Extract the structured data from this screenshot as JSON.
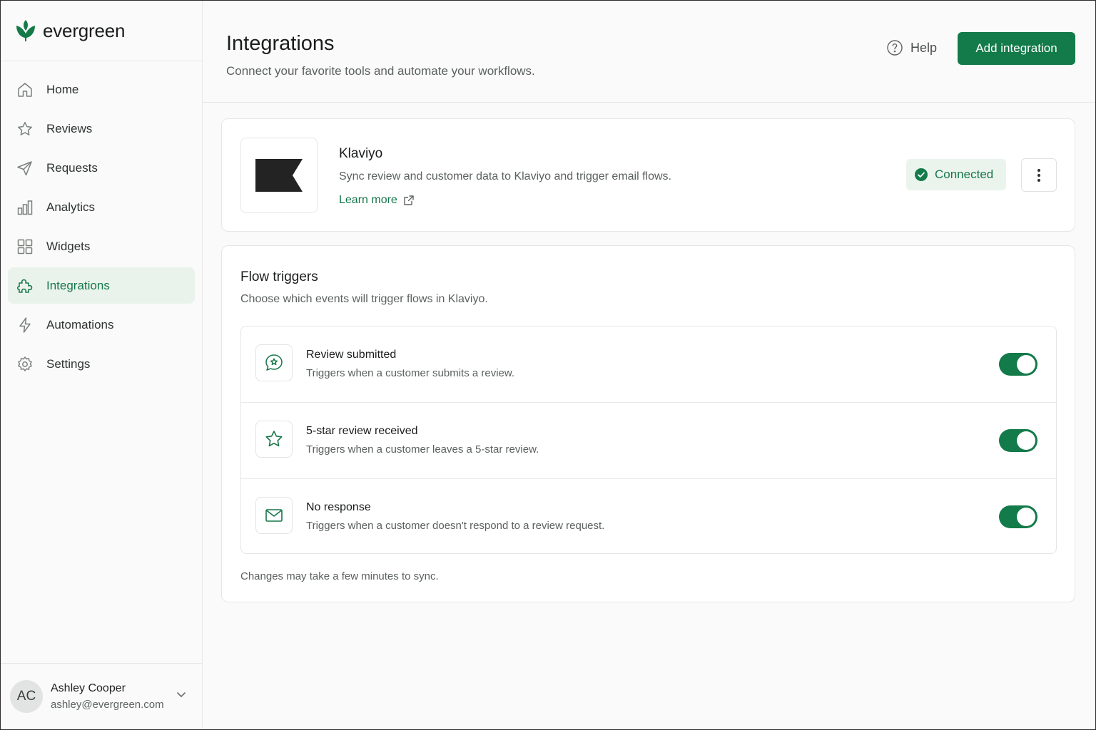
{
  "brand": {
    "name": "evergreen"
  },
  "colors": {
    "accent": "#137a49",
    "accent_light": "#e9f3ec"
  },
  "sidebar": {
    "items": [
      {
        "label": "Home",
        "icon": "home-icon"
      },
      {
        "label": "Reviews",
        "icon": "star-icon"
      },
      {
        "label": "Requests",
        "icon": "send-icon"
      },
      {
        "label": "Analytics",
        "icon": "bar-chart-icon"
      },
      {
        "label": "Widgets",
        "icon": "grid-icon"
      },
      {
        "label": "Integrations",
        "icon": "puzzle-icon",
        "active": true
      },
      {
        "label": "Automations",
        "icon": "lightning-icon"
      },
      {
        "label": "Settings",
        "icon": "gear-icon"
      }
    ]
  },
  "user": {
    "initials": "AC",
    "name": "Ashley Cooper",
    "email": "ashley@evergreen.com"
  },
  "header": {
    "title": "Integrations",
    "subtitle": "Connect your favorite tools and automate your workflows.",
    "help_label": "Help",
    "add_button_label": "Add integration"
  },
  "integration": {
    "name": "Klaviyo",
    "description": "Sync review and customer data to Klaviyo and trigger email flows.",
    "learn_more": "Learn more",
    "status": "Connected"
  },
  "flow_triggers": {
    "title": "Flow triggers",
    "subtitle": "Choose which events will trigger flows in Klaviyo.",
    "items": [
      {
        "name": "Review submitted",
        "description": "Triggers when a customer submits a review.",
        "icon": "chat-star-icon",
        "enabled": true
      },
      {
        "name": "5-star review received",
        "description": "Triggers when a customer leaves a 5-star review.",
        "icon": "star-icon",
        "enabled": true
      },
      {
        "name": "No response",
        "description": "Triggers when a customer doesn't respond to a review request.",
        "icon": "mail-icon",
        "enabled": true
      }
    ],
    "note": "Changes may take a few minutes to sync."
  }
}
